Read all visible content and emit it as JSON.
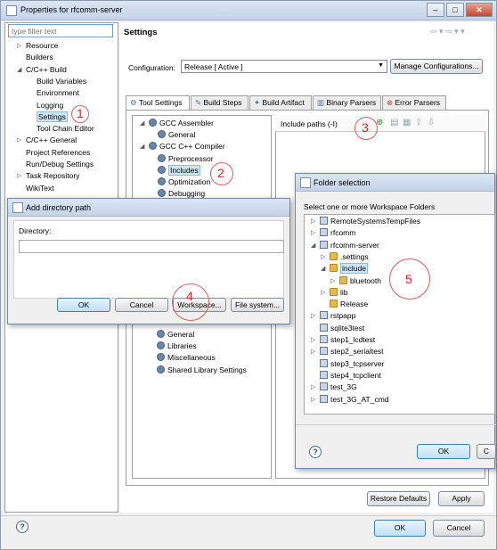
{
  "window": {
    "title": "Properties for rfcomm-server"
  },
  "filter": {
    "placeholder": "type filter text"
  },
  "left_tree": [
    {
      "label": "Resource",
      "indent": 0,
      "arrow": "▷"
    },
    {
      "label": "Builders",
      "indent": 0,
      "arrow": ""
    },
    {
      "label": "C/C++ Build",
      "indent": 0,
      "arrow": "◢"
    },
    {
      "label": "Build Variables",
      "indent": 1,
      "arrow": ""
    },
    {
      "label": "Environment",
      "indent": 1,
      "arrow": ""
    },
    {
      "label": "Logging",
      "indent": 1,
      "arrow": ""
    },
    {
      "label": "Settings",
      "indent": 1,
      "arrow": "",
      "selected": true
    },
    {
      "label": "Tool Chain Editor",
      "indent": 1,
      "arrow": ""
    },
    {
      "label": "C/C++ General",
      "indent": 0,
      "arrow": "▷"
    },
    {
      "label": "Project References",
      "indent": 0,
      "arrow": ""
    },
    {
      "label": "Run/Debug Settings",
      "indent": 0,
      "arrow": ""
    },
    {
      "label": "Task Repository",
      "indent": 0,
      "arrow": "▷"
    },
    {
      "label": "WikiText",
      "indent": 0,
      "arrow": ""
    }
  ],
  "settings": {
    "title": "Settings",
    "config_label": "Configuration:",
    "config_value": "Release  [ Active ]",
    "manage_btn": "Manage Configurations..."
  },
  "tabs": [
    "Tool Settings",
    "Build Steps",
    "Build Artifact",
    "Binary Parsers",
    "Error Parsers"
  ],
  "tool_tree": [
    {
      "label": "GCC Assembler",
      "indent": 0,
      "arrow": "◢"
    },
    {
      "label": "General",
      "indent": 1,
      "arrow": ""
    },
    {
      "label": "GCC C++ Compiler",
      "indent": 0,
      "arrow": "◢"
    },
    {
      "label": "Preprocessor",
      "indent": 1,
      "arrow": ""
    },
    {
      "label": "Includes",
      "indent": 1,
      "arrow": "",
      "selected": true
    },
    {
      "label": "Optimization",
      "indent": 1,
      "arrow": ""
    },
    {
      "label": "Debugging",
      "indent": 1,
      "arrow": ""
    }
  ],
  "tool_tree_lower": [
    "General",
    "Libraries",
    "Miscellaneous",
    "Shared Library Settings"
  ],
  "include_paths": {
    "label": "Include paths (-I)"
  },
  "bottom": {
    "restore": "Restore Defaults",
    "apply": "Apply",
    "ok": "OK",
    "cancel": "Cancel",
    "help": "?"
  },
  "add_dir": {
    "title": "Add directory path",
    "directory_label": "Directory:",
    "directory_value": "",
    "ok": "OK",
    "cancel": "Cancel",
    "workspace": "Workspace...",
    "filesystem": "File system..."
  },
  "folder_sel": {
    "title": "Folder selection",
    "prompt": "Select one or more Workspace Folders",
    "items": [
      {
        "label": "RemoteSystemsTempFiles",
        "indent": 0,
        "arrow": "▷",
        "type": "proj"
      },
      {
        "label": "rfcomm",
        "indent": 0,
        "arrow": "▷",
        "type": "proj"
      },
      {
        "label": "rfcomm-server",
        "indent": 0,
        "arrow": "◢",
        "type": "proj"
      },
      {
        "label": ".settings",
        "indent": 1,
        "arrow": "▷",
        "type": "folder"
      },
      {
        "label": "include",
        "indent": 1,
        "arrow": "◢",
        "type": "folder",
        "selected": true
      },
      {
        "label": "bluetooth",
        "indent": 2,
        "arrow": "▷",
        "type": "folder"
      },
      {
        "label": "lib",
        "indent": 1,
        "arrow": "▷",
        "type": "folder"
      },
      {
        "label": "Release",
        "indent": 1,
        "arrow": "",
        "type": "folder"
      },
      {
        "label": "rstpapp",
        "indent": 0,
        "arrow": "▷",
        "type": "proj"
      },
      {
        "label": "sqlite3test",
        "indent": 0,
        "arrow": "",
        "type": "proj"
      },
      {
        "label": "step1_lcdtest",
        "indent": 0,
        "arrow": "▷",
        "type": "proj"
      },
      {
        "label": "step2_serialtest",
        "indent": 0,
        "arrow": "▷",
        "type": "proj"
      },
      {
        "label": "step3_tcpserver",
        "indent": 0,
        "arrow": "",
        "type": "proj"
      },
      {
        "label": "step4_tcpclient",
        "indent": 0,
        "arrow": "",
        "type": "proj"
      },
      {
        "label": "test_3G",
        "indent": 0,
        "arrow": "▷",
        "type": "proj"
      },
      {
        "label": "test_3G_AT_cmd",
        "indent": 0,
        "arrow": "▷",
        "type": "proj"
      }
    ],
    "ok": "OK",
    "cancel": "C",
    "help": "?"
  },
  "annotations": [
    "1",
    "2",
    "3",
    "4",
    "5"
  ],
  "colors": {
    "accent": "#3c7fb1",
    "annotation": "#e02020",
    "selection": "#cde6f7"
  }
}
